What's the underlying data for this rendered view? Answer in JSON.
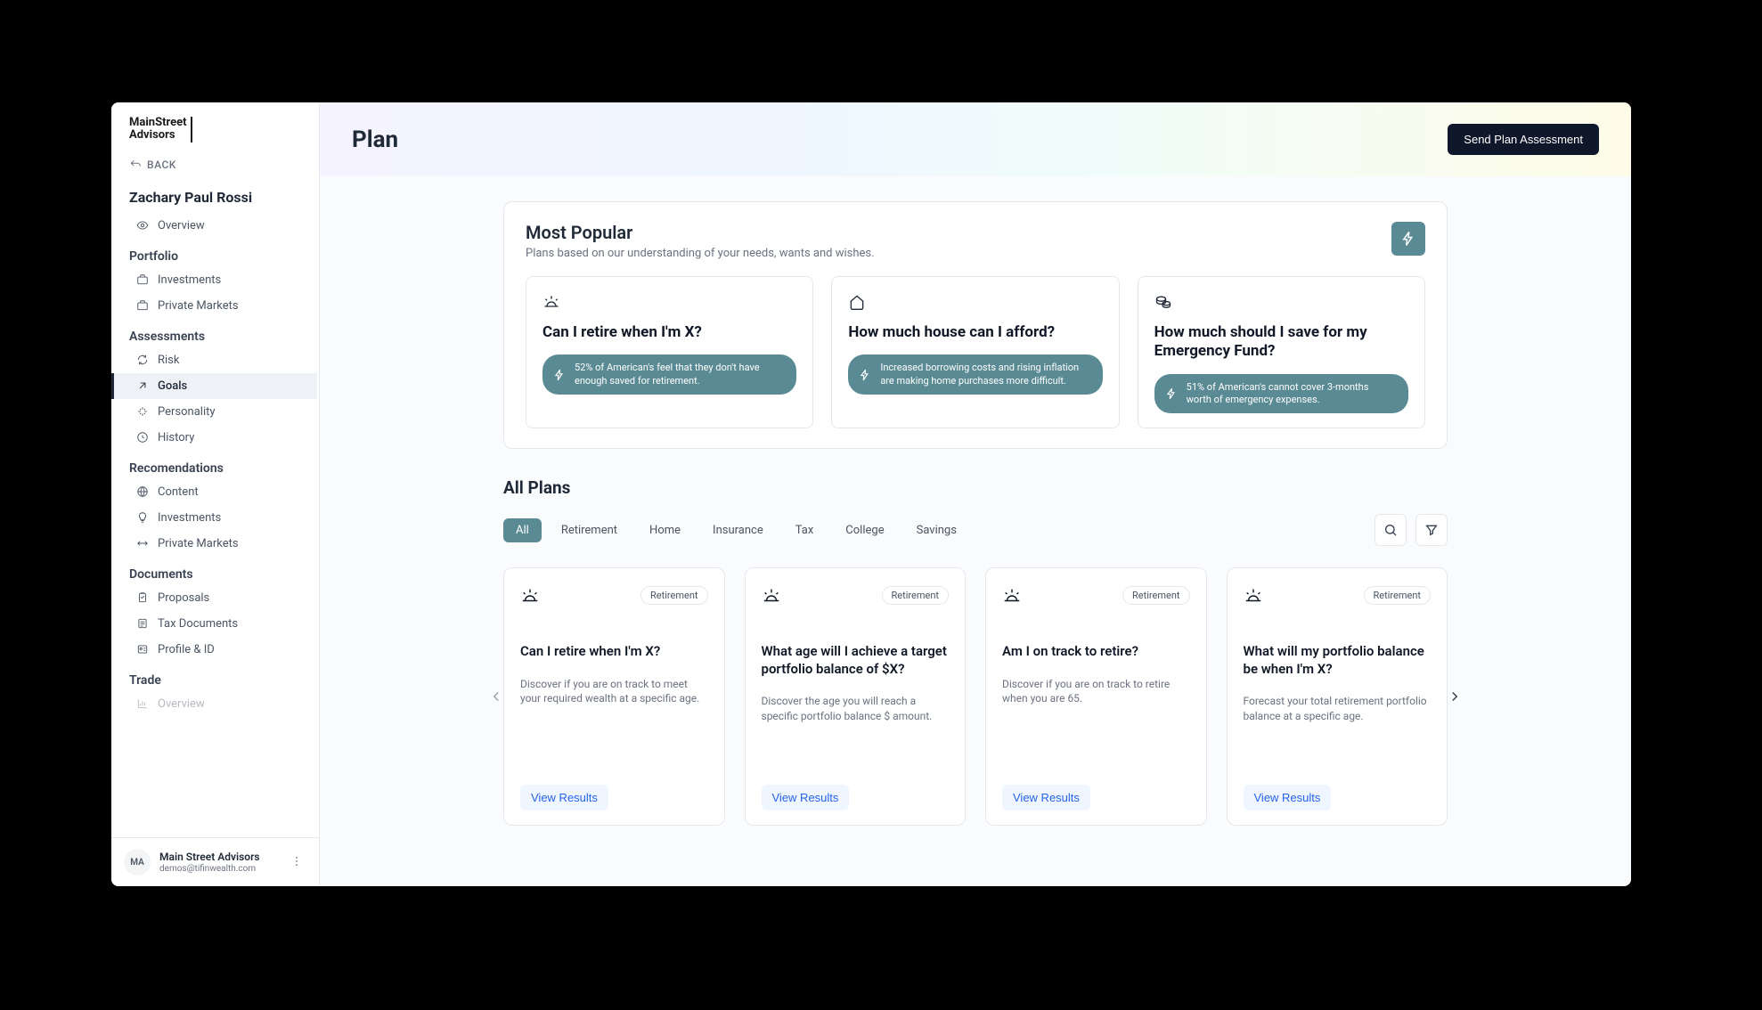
{
  "brand": {
    "line1": "MainStreet",
    "line2": "Advisors"
  },
  "back_label": "BACK",
  "client_name": "Zachary Paul Rossi",
  "nav": {
    "overview": "Overview",
    "sections": [
      {
        "title": "Portfolio",
        "items": [
          {
            "id": "investments",
            "label": "Investments"
          },
          {
            "id": "private-markets",
            "label": "Private Markets"
          }
        ]
      },
      {
        "title": "Assessments",
        "items": [
          {
            "id": "risk",
            "label": "Risk"
          },
          {
            "id": "goals",
            "label": "Goals",
            "active": true
          },
          {
            "id": "personality",
            "label": "Personality"
          },
          {
            "id": "history",
            "label": "History"
          }
        ]
      },
      {
        "title": "Recomendations",
        "items": [
          {
            "id": "content",
            "label": "Content"
          },
          {
            "id": "rec-investments",
            "label": "Investments"
          },
          {
            "id": "rec-private-markets",
            "label": "Private Markets"
          }
        ]
      },
      {
        "title": "Documents",
        "items": [
          {
            "id": "proposals",
            "label": "Proposals"
          },
          {
            "id": "tax-documents",
            "label": "Tax Documents"
          },
          {
            "id": "profile-id",
            "label": "Profile & ID"
          }
        ]
      },
      {
        "title": "Trade",
        "items": [
          {
            "id": "trade-overview",
            "label": "Overview"
          }
        ]
      }
    ]
  },
  "account": {
    "initials": "MA",
    "name": "Main Street Advisors",
    "email": "demos@tifinwealth.com"
  },
  "header": {
    "title": "Plan",
    "cta": "Send Plan Assessment"
  },
  "popular": {
    "title": "Most Popular",
    "subtitle": "Plans based on our understanding of your needs, wants and wishes.",
    "items": [
      {
        "icon": "sunrise",
        "question": "Can I retire when I'm X?",
        "stat": "52% of American's feel that they don't have enough saved for retirement."
      },
      {
        "icon": "home",
        "question": "How much house can I afford?",
        "stat": "Increased borrowing costs and rising inflation are making home purchases more difficult."
      },
      {
        "icon": "coins",
        "question": "How much should I save for my Emergency Fund?",
        "stat": "51% of American's cannot cover 3-months worth of emergency expenses."
      }
    ]
  },
  "all_plans": {
    "title": "All Plans",
    "tabs": [
      "All",
      "Retirement",
      "Home",
      "Insurance",
      "Tax",
      "College",
      "Savings"
    ],
    "active_tab": "All",
    "cards": [
      {
        "category": "Retirement",
        "question": "Can I retire when I'm X?",
        "desc": "Discover if you are on track to meet your required wealth at a specific age.",
        "cta": "View Results"
      },
      {
        "category": "Retirement",
        "question": "What age will I achieve a target portfolio balance of $X?",
        "desc": "Discover the age you will reach a specific portfolio balance $ amount.",
        "cta": "View Results"
      },
      {
        "category": "Retirement",
        "question": "Am I on track to retire?",
        "desc": "Discover if you are on track to retire when you are 65.",
        "cta": "View Results"
      },
      {
        "category": "Retirement",
        "question": "What will my portfolio balance be when I'm X?",
        "desc": "Forecast your total retirement portfolio balance at a specific age.",
        "cta": "View Results"
      }
    ]
  }
}
